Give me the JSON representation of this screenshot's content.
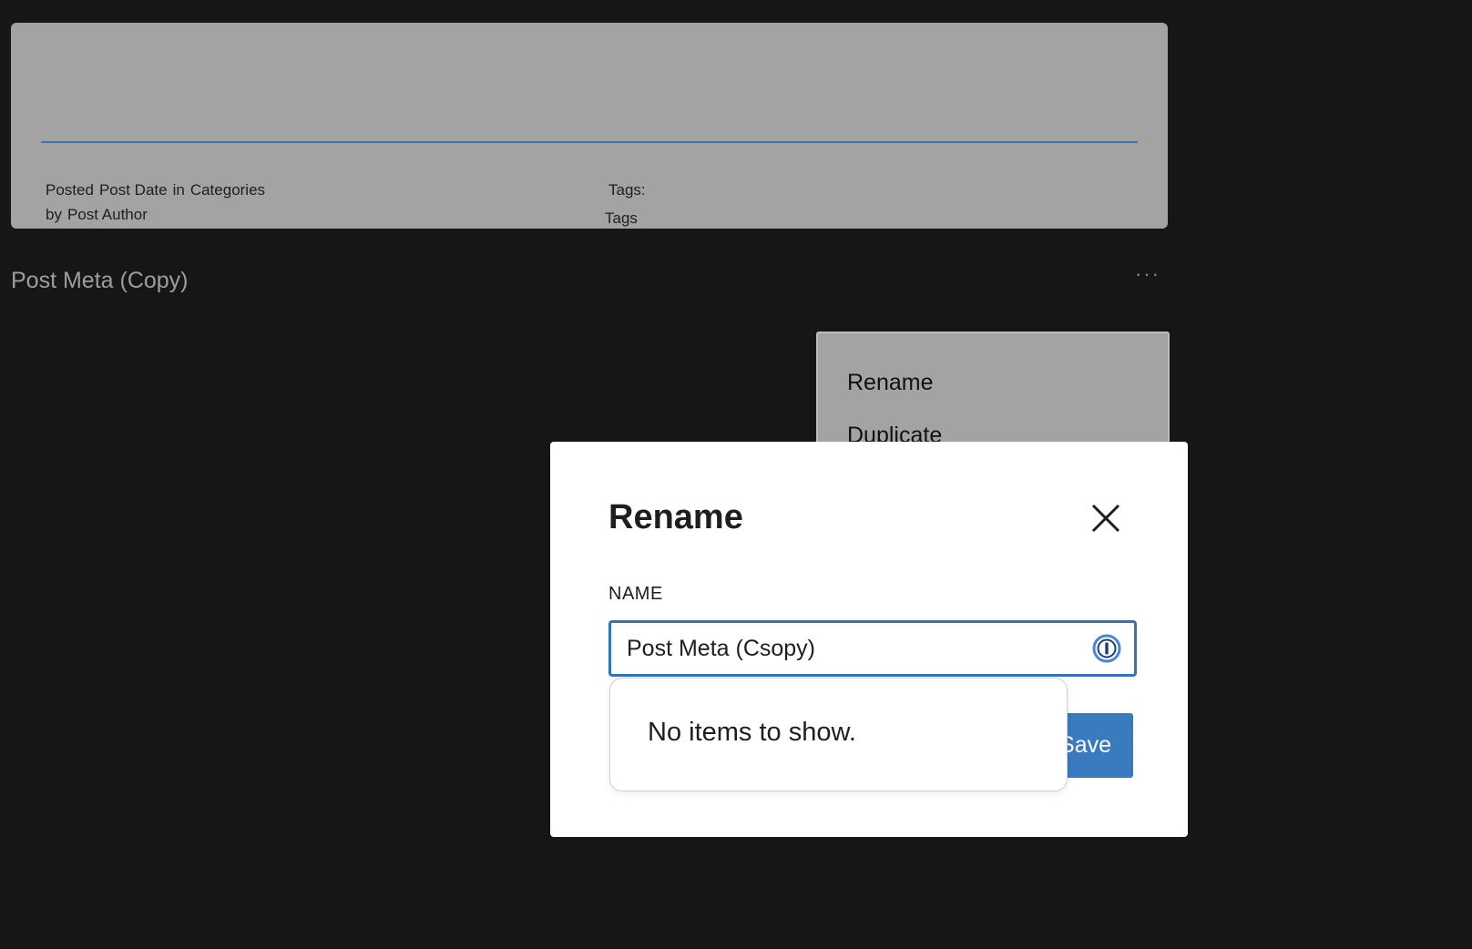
{
  "pattern_preview": {
    "posted_label": "Posted",
    "post_date": "Post Date",
    "in_label": "in",
    "categories": "Categories",
    "by_label": "by",
    "post_author": "Post Author",
    "tags_label": "Tags:",
    "tags_value": "Tags"
  },
  "pattern": {
    "title": "Post Meta (Copy)",
    "more_label": "···"
  },
  "dropdown": {
    "items": [
      {
        "label": "Rename"
      },
      {
        "label": "Duplicate"
      }
    ]
  },
  "modal": {
    "title": "Rename",
    "field_label": "NAME",
    "name_value": "Post Meta (Csopy)",
    "save_label": "Save",
    "close_icon": "close-icon",
    "password_manager_icon": "password-manager-icon"
  },
  "autocomplete": {
    "empty_text": "No items to show."
  },
  "colors": {
    "accent": "#3474b4",
    "button": "#3a7abe",
    "background": "#161616",
    "card": "#a3a3a3"
  }
}
